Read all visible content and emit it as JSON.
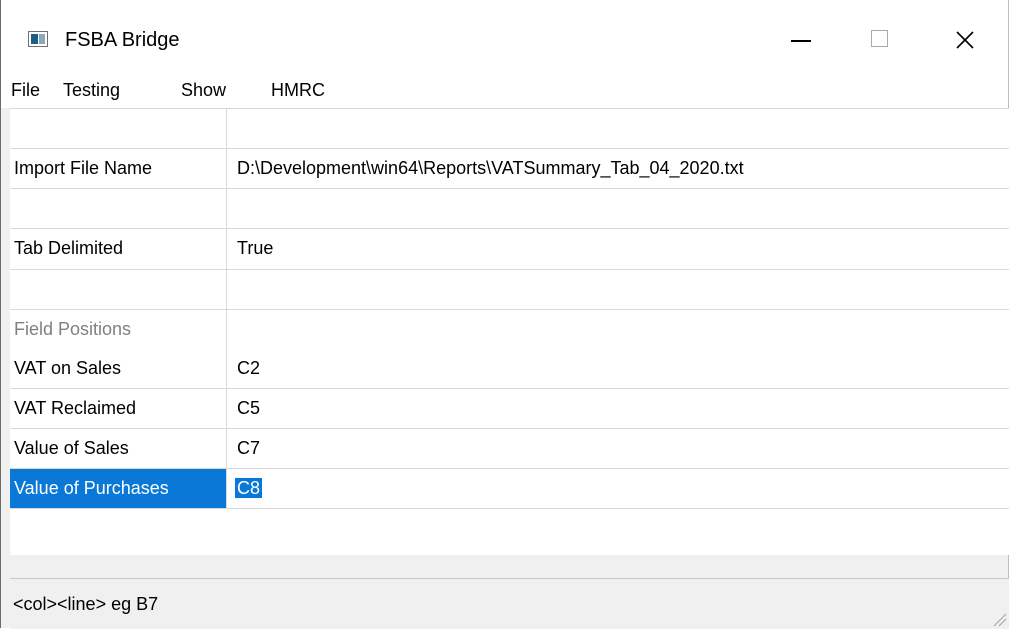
{
  "window": {
    "title": "FSBA Bridge"
  },
  "menu": [
    "File",
    "Testing",
    "Show",
    "HMRC"
  ],
  "grid": {
    "rows": [
      {
        "key": "",
        "value": ""
      },
      {
        "key": "Import File Name",
        "value": "D:\\Development\\win64\\Reports\\VATSummary_Tab_04_2020.txt"
      },
      {
        "key": "",
        "value": ""
      },
      {
        "key": "Tab Delimited",
        "value": "True"
      },
      {
        "key": "",
        "value": ""
      },
      {
        "key": "Field Positions",
        "value": "",
        "style": "header"
      },
      {
        "key": "VAT on Sales",
        "value": "C2"
      },
      {
        "key": "VAT Reclaimed",
        "value": "C5"
      },
      {
        "key": "Value of Sales",
        "value": "C7"
      },
      {
        "key": "Value of Purchases",
        "value": "C8",
        "selected": true
      }
    ]
  },
  "status": {
    "text": "<col><line> eg B7"
  },
  "colors": {
    "selection": "#0a78d7",
    "grid_line": "#d9d9d9",
    "header_text": "#808080"
  }
}
